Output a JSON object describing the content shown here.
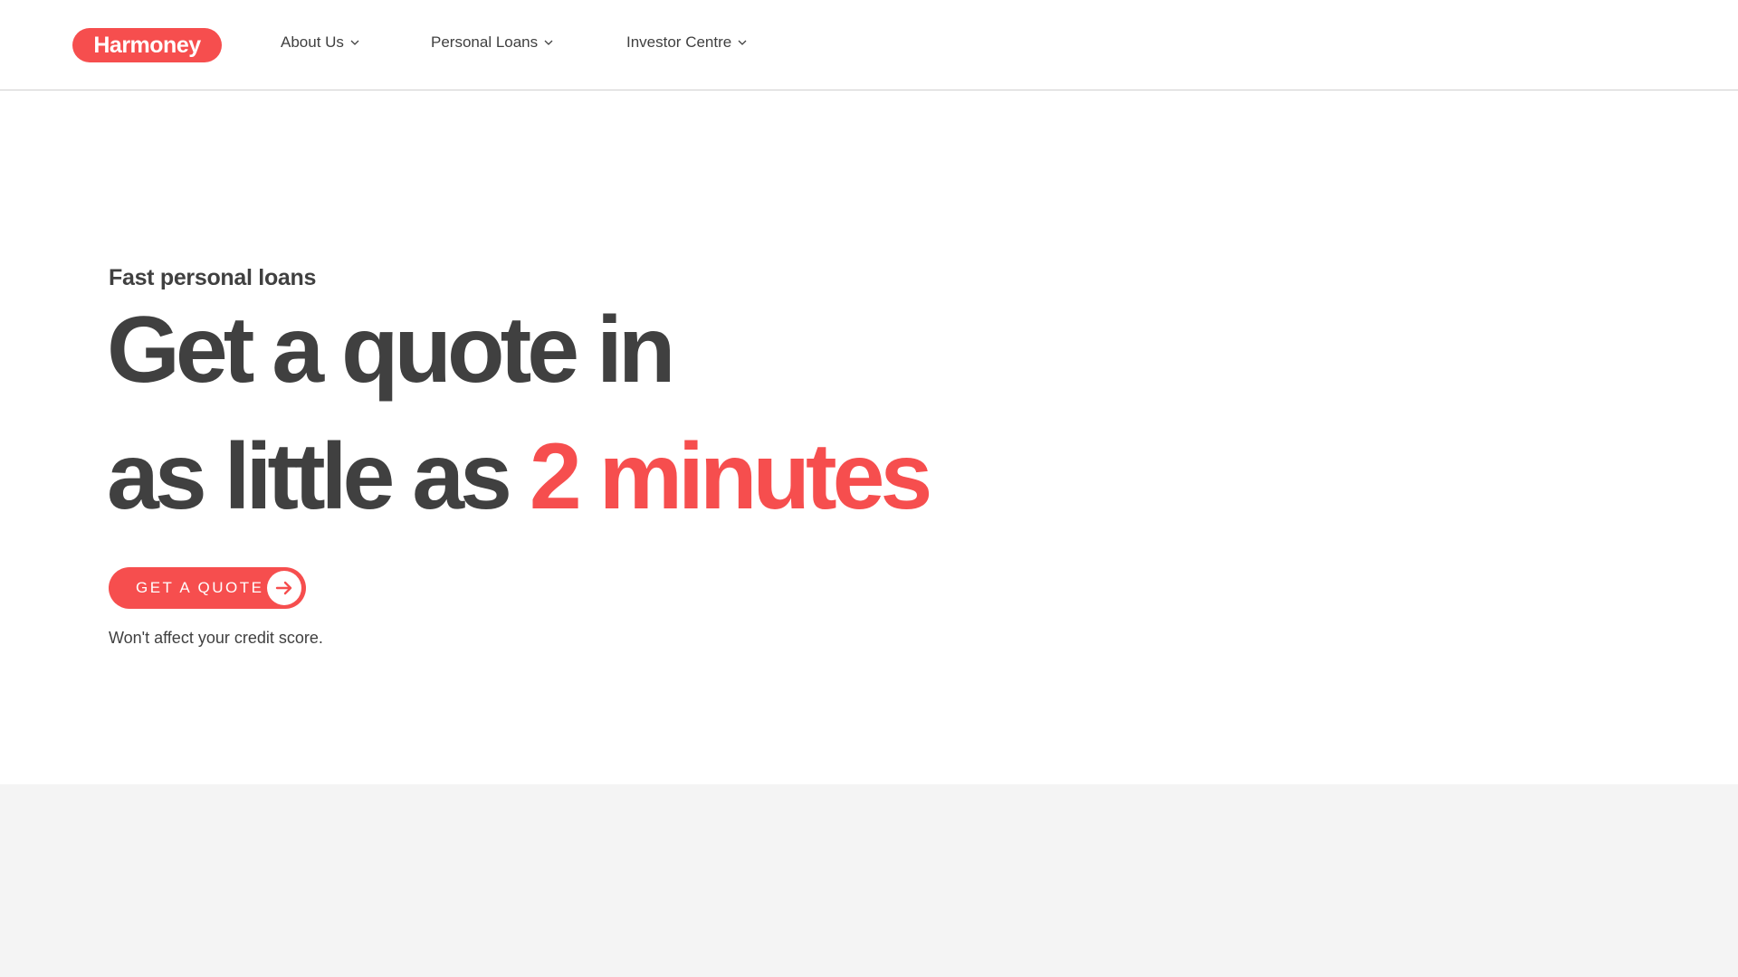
{
  "colors": {
    "brand": "#f64e4e",
    "text": "#404040",
    "band": "#f4f4f4"
  },
  "header": {
    "logo_text": "Harmoney",
    "nav": [
      {
        "label": "About Us",
        "icon": "chevron-down-icon"
      },
      {
        "label": "Personal Loans",
        "icon": "chevron-down-icon"
      },
      {
        "label": "Investor Centre",
        "icon": "chevron-down-icon"
      }
    ]
  },
  "hero": {
    "eyebrow": "Fast personal loans",
    "headline_line1": "Get a quote in",
    "headline_line2_prefix": "as little as ",
    "headline_line2_accent": "2 minutes",
    "cta_label": "GET A QUOTE",
    "cta_icon": "arrow-right-icon",
    "note": "Won't affect your credit score."
  }
}
